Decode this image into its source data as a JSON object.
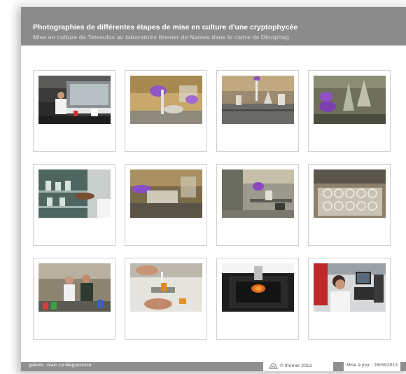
{
  "header": {
    "title": "Photographies de différentes étapes de mise en culture d'une cryptophycée",
    "subtitle": "Mise en culture de Teleaulax au laboratoire Ifremer de Nantes dans le cadre de Dinophag"
  },
  "gallery": {
    "photos": [
      {
        "subject": "laboratory-hood-worker"
      },
      {
        "subject": "gloved-hands-pipette-flask"
      },
      {
        "subject": "pipette-glassware-bench"
      },
      {
        "subject": "gloved-hands-conical-flasks"
      },
      {
        "subject": "glass-shelf-culture-flasks"
      },
      {
        "subject": "gloved-hand-culture-plate"
      },
      {
        "subject": "bench-pipetting-purple-glove"
      },
      {
        "subject": "multiwell-culture-plates"
      },
      {
        "subject": "two-researchers-lab"
      },
      {
        "subject": "pipetting-orange-sample"
      },
      {
        "subject": "microscope-stage-orange-well"
      },
      {
        "subject": "researcher-at-microscope"
      }
    ]
  },
  "footer": {
    "credit": "galerie : Alain Le Magueresse",
    "copyright": "© Ifremer 2013",
    "updated": "Mise à jour : 28/06/2013",
    "logo_icon": "ifremer-logo-icon"
  }
}
